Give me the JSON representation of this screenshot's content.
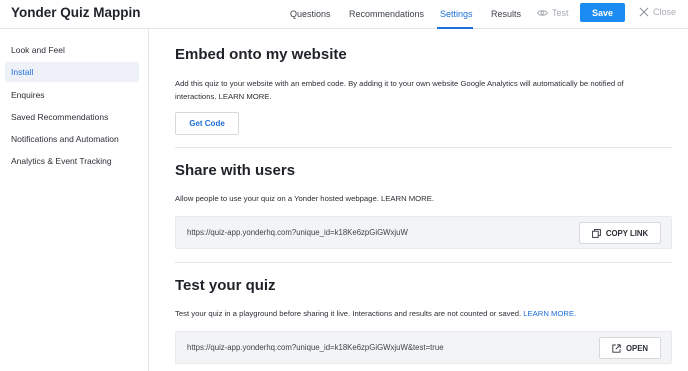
{
  "header": {
    "app_title": "Yonder Quiz Mapping Ex",
    "tabs": [
      {
        "label": "Questions"
      },
      {
        "label": "Recommendations"
      },
      {
        "label": "Settings"
      },
      {
        "label": "Results"
      }
    ],
    "test_label": "Test",
    "save_label": "Save",
    "close_label": "Close"
  },
  "sidebar": {
    "items": [
      {
        "label": "Look and Feel"
      },
      {
        "label": "Install"
      },
      {
        "label": "Enquires"
      },
      {
        "label": "Saved Recommendations"
      },
      {
        "label": "Notifications and Automation"
      },
      {
        "label": "Analytics & Event Tracking"
      }
    ],
    "active": "Install"
  },
  "embed": {
    "title": "Embed onto my website",
    "description": "Add this quiz to your website with an embed code. By adding it to your own website Google Analytics will automatically be notified of interactions. LEARN MORE.",
    "button_label": "Get Code"
  },
  "share": {
    "title": "Share with users",
    "description": "Allow people to use your quiz on a Yonder hosted webpage. LEARN MORE.",
    "url": "https://quiz-app.yonderhq.com?unique_id=k18Ke6zpGiGWxjuW",
    "button_label": "COPY LINK"
  },
  "test": {
    "title": "Test your quiz",
    "description": "Test your quiz in a playground before sharing it live. Interactions and results are not counted or saved.",
    "learn_more": "LEARN MORE.",
    "url": "https://quiz-app.yonderhq.com?unique_id=k18Ke6zpGiGWxjuW&test=true",
    "button_label": "OPEN"
  },
  "colors": {
    "accent": "#1e6fd9",
    "save_button": "#1a8bf0",
    "active_sidebar_bg": "#eef2f8"
  }
}
